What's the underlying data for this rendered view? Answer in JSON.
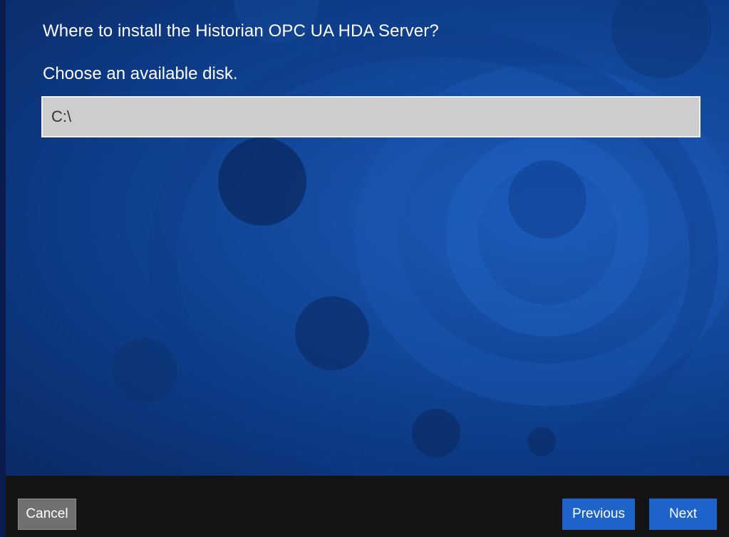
{
  "page": {
    "heading": "Where to install the Historian OPC UA HDA Server?",
    "subheading": "Choose an available disk."
  },
  "disk_field": {
    "value": "C:\\"
  },
  "footer": {
    "cancel_label": "Cancel",
    "previous_label": "Previous",
    "next_label": "Next"
  },
  "colors": {
    "background_primary": "#134a9e",
    "footer_background": "#141414",
    "primary_button": "#1e63c9",
    "secondary_button": "#707070",
    "field_background": "#cdcdcd"
  }
}
